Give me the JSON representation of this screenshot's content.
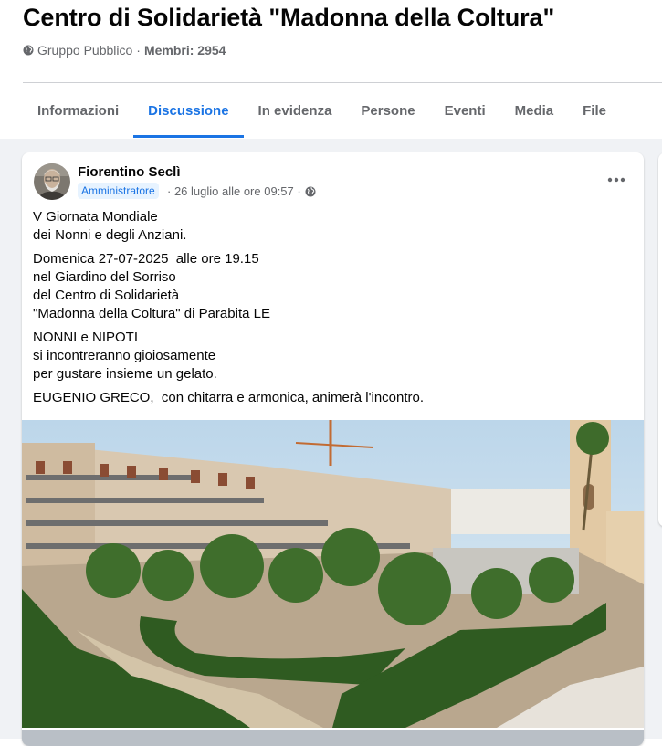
{
  "group": {
    "title": "Centro di Solidarietà \"Madonna della Coltura\"",
    "privacy": "Gruppo Pubblico",
    "separator": "·",
    "members_label": "Membri: 2954"
  },
  "tabs": [
    {
      "label": "Informazioni",
      "active": false
    },
    {
      "label": "Discussione",
      "active": true
    },
    {
      "label": "In evidenza",
      "active": false
    },
    {
      "label": "Persone",
      "active": false
    },
    {
      "label": "Eventi",
      "active": false
    },
    {
      "label": "Media",
      "active": false
    },
    {
      "label": "File",
      "active": false
    }
  ],
  "post": {
    "author": "Fiorentino Seclì",
    "role_badge": "Amministratore",
    "timestamp": "· 26 luglio alle ore 09:57 ·",
    "paragraphs": [
      [
        "V Giornata Mondiale",
        "dei Nonni e degli Anziani."
      ],
      [
        "Domenica 27-07-2025  alle ore 19.15",
        "nel Giardino del Sorriso",
        "del Centro di Solidarietà",
        "\"Madonna della Coltura\" di Parabita LE"
      ],
      [
        "NONNI e NIPOTI",
        "si incontreranno gioiosamente",
        "per gustare insieme un gelato."
      ],
      [
        "EUGENIO GRECO,  con chitarra e armonica, animerà l'incontro."
      ]
    ]
  },
  "icons": {
    "privacy": "globe-icon",
    "audience": "globe-icon",
    "more": "more-horizontal-icon"
  },
  "colors": {
    "accent": "#1b74e4",
    "secondary_text": "#65676b",
    "feed_background": "#f0f2f5",
    "badge_background": "#e7f3ff"
  }
}
